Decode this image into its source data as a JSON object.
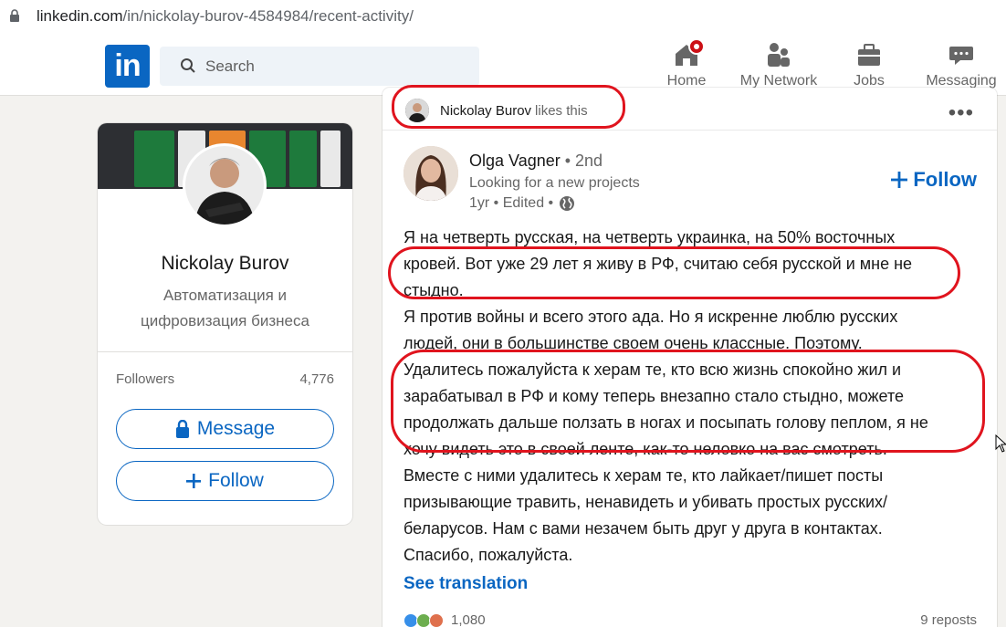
{
  "browser": {
    "url_host": "linkedin.com",
    "url_path": "/in/nickolay-burov-4584984/recent-activity/"
  },
  "nav": {
    "logo": "in",
    "search_placeholder": "Search",
    "items": [
      {
        "label": "Home",
        "icon": "home-icon"
      },
      {
        "label": "My Network",
        "icon": "network-icon"
      },
      {
        "label": "Jobs",
        "icon": "briefcase-icon"
      },
      {
        "label": "Messaging",
        "icon": "messaging-icon"
      }
    ]
  },
  "profile": {
    "name": "Nickolay Burov",
    "title": "Автоматизация и цифровизация бизнеса",
    "followers_label": "Followers",
    "followers_count": "4,776",
    "message_button": "Message",
    "follow_button": "Follow"
  },
  "post": {
    "liker_name": "Nickolay Burov",
    "liker_action": "likes this",
    "author_name": "Olga Vagner",
    "author_degree": " • 2nd",
    "author_headline": "Looking for a new projects",
    "meta": "1yr • Edited •",
    "follow_label": "Follow",
    "body_lines": [
      "Я на четверть русская, на четверть украинка, на 50% восточных",
      "кровей. Вот уже 29 лет я живу в РФ, считаю себя русской и мне не",
      "стыдно.",
      "Я против войны и всего этого ада. Но я искренне люблю русских",
      "людей, они в большинстве своем очень классные. Поэтому.",
      "Удалитесь пожалуйста к херам те, кто всю жизнь спокойно жил и",
      "зарабатывал в РФ и кому теперь внезапно стало стыдно, можете",
      "продолжать дальше ползать в ногах и посыпать голову пеплом, я не",
      "хочу видеть это в своей ленте, как-то неловко на вас смотреть.",
      "Вместе с ними удалитесь к херам те, кто лайкает/пишет посты",
      "призывающие травить, ненавидеть и убивать простых русских/",
      "беларусов. Нам с вами незачем быть друг у друга в контактах.",
      "Спасибо, пожалуйста."
    ],
    "see_translation": "See translation",
    "reactions_count": "1,080",
    "reposts": "9 reposts"
  },
  "colors": {
    "brand": "#0a66c2",
    "annotation": "#e0141e",
    "notification": "#cc1016"
  }
}
